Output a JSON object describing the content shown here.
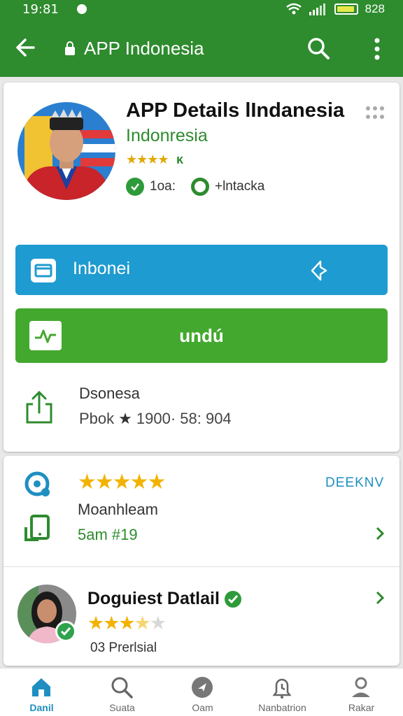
{
  "status": {
    "time": "19:81",
    "battery": "828"
  },
  "toolbar": {
    "title": "APP Indonesia"
  },
  "app": {
    "title": "APP Details lIndanesia",
    "subtitle": "Indonresia",
    "rating_small": "★★★★",
    "tiny_badge": "ᴋ",
    "meta_left": "1oa:",
    "meta_right": "+lntacka"
  },
  "buttons": {
    "primary_label": "Inbonei",
    "install_label": "undú"
  },
  "share": {
    "title": "Dsonesa",
    "meta_prefix": "Pbok",
    "meta_value": "1900· 58: 904"
  },
  "review_summary": {
    "stars": "★★★★★",
    "link": "DEEKNV",
    "name": "Moanhleam",
    "sub": "5am #19"
  },
  "developer": {
    "title": "Doguiest Datlail",
    "stars_on": "★★★",
    "stars_half": "★",
    "stars_off": "★",
    "sub": "03 Prerlsial",
    "rating": 3.5
  },
  "nav": [
    {
      "label": "Danil",
      "icon": "home-icon",
      "active": true
    },
    {
      "label": "Suata",
      "icon": "search-icon",
      "active": false
    },
    {
      "label": "Oam",
      "icon": "compass-icon",
      "active": false
    },
    {
      "label": "Nanbatrion",
      "icon": "notification-icon",
      "active": false
    },
    {
      "label": "Rakar",
      "icon": "profile-icon",
      "active": false
    }
  ],
  "colors": {
    "primary_green": "#2e8b2e",
    "button_blue": "#1e9bd0",
    "button_green": "#43a82e",
    "star": "#f2b300"
  }
}
